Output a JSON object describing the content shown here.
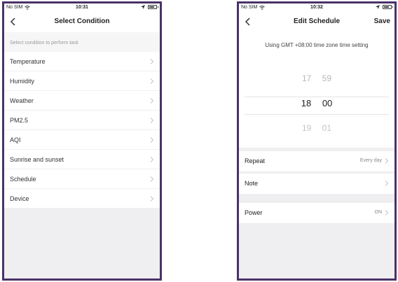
{
  "left": {
    "status": {
      "carrier": "No SIM",
      "time": "10:31"
    },
    "title": "Select Condition",
    "hint": "Select condition to perform task",
    "items": [
      {
        "label": "Temperature"
      },
      {
        "label": "Humidity"
      },
      {
        "label": "Weather"
      },
      {
        "label": "PM2.5"
      },
      {
        "label": "AQI"
      },
      {
        "label": "Sunrise and sunset"
      },
      {
        "label": "Schedule"
      },
      {
        "label": "Device"
      }
    ]
  },
  "right": {
    "status": {
      "carrier": "No SIM",
      "time": "10:32"
    },
    "title": "Edit Schedule",
    "save_label": "Save",
    "timezone_note": "Using GMT +08:00 time zone time setting",
    "picker": {
      "prev": {
        "hour": "17",
        "minute": "59"
      },
      "selected": {
        "hour": "18",
        "minute": "00"
      },
      "next": {
        "hour": "19",
        "minute": "01"
      }
    },
    "repeat": {
      "label": "Repeat",
      "value": "Every day"
    },
    "note": {
      "label": "Note"
    },
    "power": {
      "label": "Power",
      "value": "ON"
    }
  },
  "colors": {
    "frame": "#4a3268",
    "background": "#efeef1",
    "row": "#ffffff",
    "hint_text": "#9a9a9a"
  },
  "icons": [
    "back-icon",
    "chevron-right-icon",
    "wifi-icon",
    "location-arrow-icon",
    "battery-icon"
  ]
}
